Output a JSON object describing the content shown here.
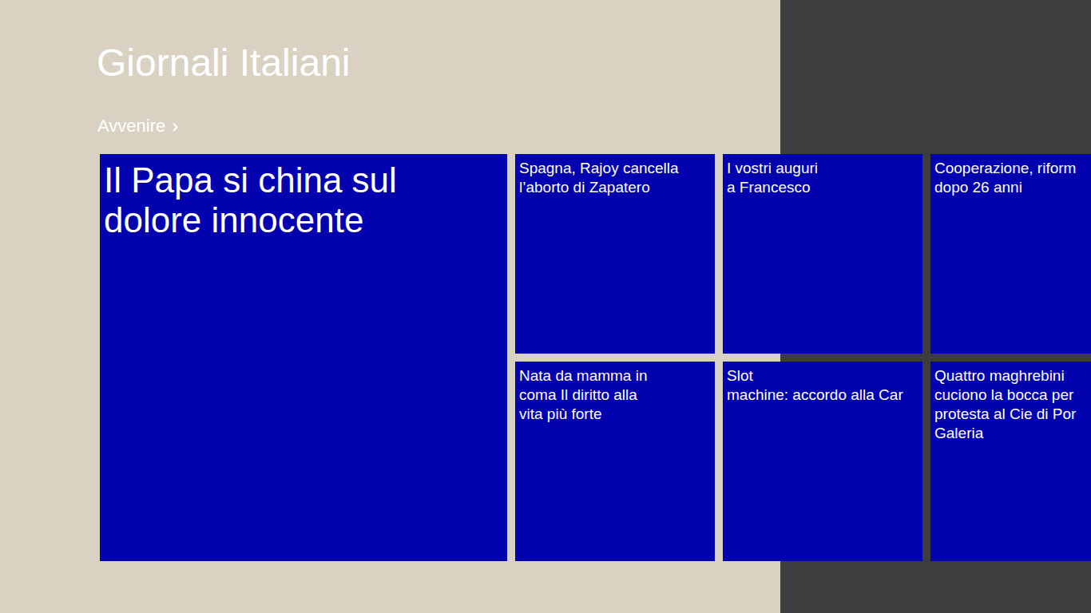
{
  "app": {
    "title": "Giornali Italiani"
  },
  "section": {
    "label": "Avvenire",
    "chevron": "›"
  },
  "featured": {
    "headline": "Il Papa si china sul\ndolore innocente"
  },
  "tiles": [
    {
      "headline": "Spagna, Rajoy cancella\nl’aborto di Zapatero"
    },
    {
      "headline": "Nata da mamma in\ncoma Il diritto alla\nvita più forte"
    },
    {
      "headline": "I vostri auguri\na Francesco"
    },
    {
      "headline": "Slot\nmachine: accordo alla Car"
    },
    {
      "headline": "Cooperazione, riform\ndopo 26 anni"
    },
    {
      "headline": "Quattro maghrebini\ncuciono la bocca per\nprotesta al Cie di Por\nGaleria"
    }
  ]
}
